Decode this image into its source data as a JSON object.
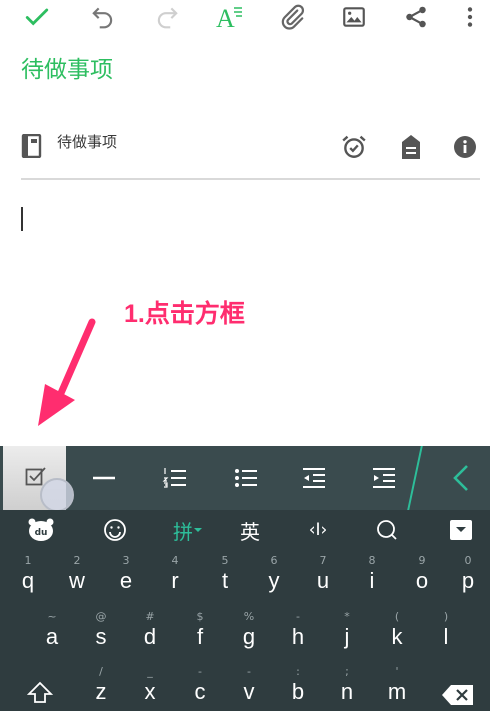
{
  "toolbar": {
    "icons": [
      "check-icon",
      "undo-icon",
      "redo-icon",
      "text-format-icon",
      "attachment-icon",
      "image-icon",
      "share-icon",
      "more-vert-icon"
    ],
    "accent": "#2dbe60"
  },
  "note": {
    "title": "待做事项",
    "notebook": "待做事项"
  },
  "annotation": {
    "text": "1.点击方框",
    "color": "#ff2d6f"
  },
  "keyboard": {
    "top": {
      "pinyin": "拼",
      "english": "英",
      "cursor": "‹I›"
    },
    "row1": [
      {
        "main": "q",
        "sub": "1"
      },
      {
        "main": "w",
        "sub": "2"
      },
      {
        "main": "e",
        "sub": "3"
      },
      {
        "main": "r",
        "sub": "4"
      },
      {
        "main": "t",
        "sub": "5"
      },
      {
        "main": "y",
        "sub": "6"
      },
      {
        "main": "u",
        "sub": "7"
      },
      {
        "main": "i",
        "sub": "8"
      },
      {
        "main": "o",
        "sub": "9"
      },
      {
        "main": "p",
        "sub": "0"
      }
    ],
    "row2": [
      {
        "main": "a",
        "sub": "~"
      },
      {
        "main": "s",
        "sub": "@"
      },
      {
        "main": "d",
        "sub": "#"
      },
      {
        "main": "f",
        "sub": "$"
      },
      {
        "main": "g",
        "sub": "%"
      },
      {
        "main": "h",
        "sub": "-"
      },
      {
        "main": "j",
        "sub": "*"
      },
      {
        "main": "k",
        "sub": "("
      },
      {
        "main": "l",
        "sub": ")"
      }
    ],
    "row3": [
      {
        "main": "z",
        "sub": "/"
      },
      {
        "main": "x",
        "sub": "_"
      },
      {
        "main": "c",
        "sub": "-"
      },
      {
        "main": "v",
        "sub": "-"
      },
      {
        "main": "b",
        "sub": ":"
      },
      {
        "main": "n",
        "sub": ";"
      },
      {
        "main": "m",
        "sub": "'"
      }
    ]
  }
}
